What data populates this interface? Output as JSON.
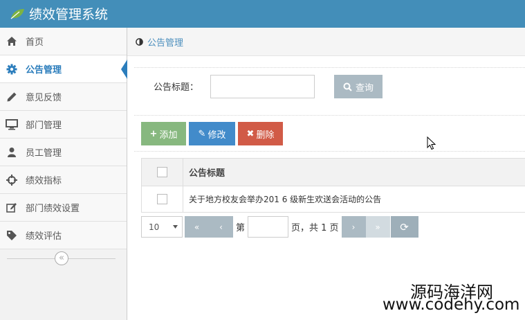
{
  "app": {
    "title": "绩效管理系统"
  },
  "sidebar": {
    "items": [
      {
        "label": "首页",
        "icon": "home-icon"
      },
      {
        "label": "公告管理",
        "icon": "gear-icon",
        "active": true
      },
      {
        "label": "意见反馈",
        "icon": "pencil-icon"
      },
      {
        "label": "部门管理",
        "icon": "monitor-icon"
      },
      {
        "label": "员工管理",
        "icon": "user-icon"
      },
      {
        "label": "绩效指标",
        "icon": "crosshairs-icon"
      },
      {
        "label": "部门绩效设置",
        "icon": "edit-icon"
      },
      {
        "label": "绩效评估",
        "icon": "tag-icon"
      }
    ],
    "collapse_glyph": "«"
  },
  "breadcrumb": {
    "text": "公告管理"
  },
  "search": {
    "label": "公告标题：",
    "value": "",
    "button_label": "查询"
  },
  "toolbar": {
    "add_label": "添加",
    "add_glyph": "+",
    "edit_label": "修改",
    "edit_glyph": "✎",
    "delete_label": "删除",
    "delete_glyph": "✖"
  },
  "table": {
    "columns": [
      "公告标题"
    ],
    "rows": [
      {
        "title": "关于地方校友会举办201 6 级新生欢送会活动的公告"
      }
    ]
  },
  "pagination": {
    "page_size": "10",
    "first": "«",
    "prev": "‹",
    "next": "›",
    "last": "»",
    "page_prefix": "第",
    "current_page": "",
    "page_suffix": "页，共 1 页",
    "refresh_glyph": "⟳"
  },
  "watermark": {
    "cn": "源码海洋网",
    "en": "www.codehy.com"
  },
  "colors": {
    "header": "#438eb9",
    "active": "#2b7dbc",
    "add": "#87b87f",
    "edit": "#428bca",
    "delete": "#d15b47",
    "grey_button": "#abbac3"
  }
}
